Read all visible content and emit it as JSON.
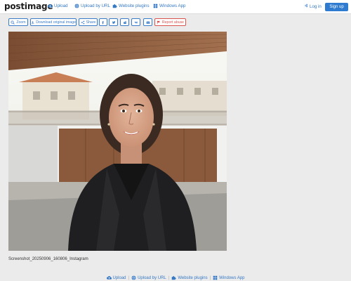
{
  "header": {
    "logo": "postimage",
    "nav": [
      {
        "label": "Upload",
        "icon": "cloud-upload-icon"
      },
      {
        "label": "Upload by URL",
        "icon": "globe-icon"
      },
      {
        "label": "Website plugins",
        "icon": "puzzle-icon"
      },
      {
        "label": "Windows App",
        "icon": "windows-icon"
      }
    ],
    "login": "Log in",
    "signup": "Sign up"
  },
  "toolbar": {
    "zoom": "Zoom",
    "download": "Download original image",
    "share": "Share",
    "report": "Report abuse",
    "social_icons": [
      "facebook-icon",
      "twitter-icon",
      "reddit-icon",
      "vk-icon",
      "email-icon"
    ]
  },
  "image": {
    "caption": "Screenshot_20250906_160806_Instagram"
  },
  "footer": {
    "items": [
      "Upload",
      "Upload by URL",
      "Website plugins",
      "Windows App"
    ],
    "separator": "|"
  },
  "colors": {
    "accent": "#3578c4",
    "button": "#2f7bd0",
    "danger": "#d9534f",
    "background": "#ebebeb"
  }
}
